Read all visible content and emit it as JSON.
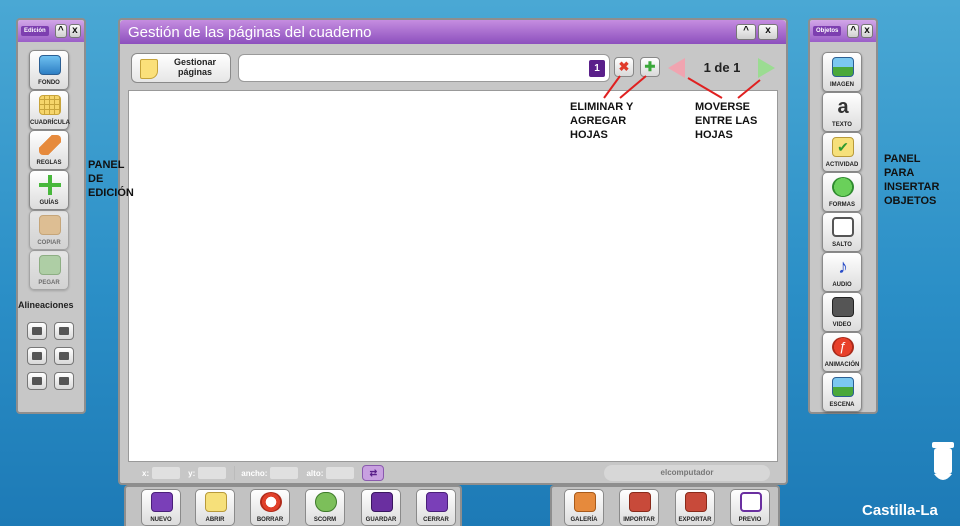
{
  "main_window": {
    "title": "Gestión de las páginas del cuaderno",
    "manage_pages_button": "Gestionar páginas",
    "page_number_badge": "1",
    "page_counter": "1 de 1",
    "minimize_symbol": "^",
    "close_symbol": "x"
  },
  "left_panel": {
    "mini_title": "Edición",
    "minimize_symbol": "^",
    "close_symbol": "x",
    "tools": [
      "FONDO",
      "CUADRÍCULA",
      "REGLAS",
      "GUÍAS",
      "COPIAR",
      "PEGAR"
    ],
    "alignments_title": "Alineaciones"
  },
  "right_panel": {
    "mini_title": "Objetos",
    "minimize_symbol": "^",
    "close_symbol": "x",
    "tools": [
      "IMAGEN",
      "TEXTO",
      "ACTIVIDAD",
      "FORMAS",
      "SALTO",
      "AUDIO",
      "VIDEO",
      "ANIMACIÓN",
      "ESCENA"
    ]
  },
  "status_bar": {
    "x_label": "x:",
    "y_label": "y:",
    "width_label": "ancho:",
    "height_label": "alto:",
    "credit": "elcomputador"
  },
  "bottom_toolbar": {
    "file_buttons": [
      "NUEVO",
      "ABRIR",
      "BORRAR",
      "SCORM",
      "GUARDAR",
      "CERRAR"
    ],
    "media_buttons": [
      "GALERÍA",
      "IMPORTAR",
      "EXPORTAR",
      "PREVIO"
    ]
  },
  "annotations": {
    "left_panel_line1": "PANEL",
    "left_panel_line2": "DE",
    "left_panel_line3": "EDICIÓN",
    "add_remove_line1": "ELIMINAR Y",
    "add_remove_line2": "AGREGAR",
    "add_remove_line3": "HOJAS",
    "move_line1": "MOVERSE",
    "move_line2": "ENTRE LAS",
    "move_line3": "HOJAS",
    "right_panel_line1": "PANEL",
    "right_panel_line2": "PARA",
    "right_panel_line3": "INSERTAR",
    "right_panel_line4": "OBJETOS"
  },
  "brand": {
    "logo_text": "Castilla-La"
  },
  "colors": {
    "accent_purple": "#9a5ec8",
    "background_blue": "#2b8fc7"
  }
}
